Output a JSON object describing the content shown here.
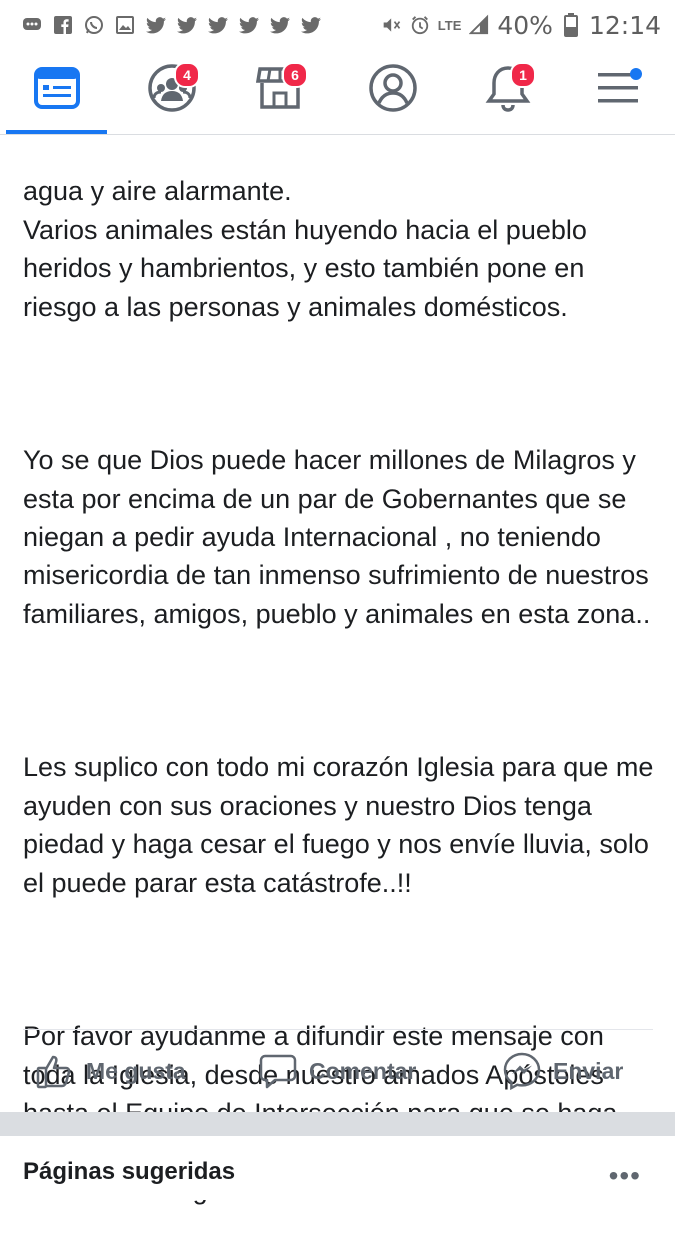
{
  "status_bar": {
    "battery": "40%",
    "time": "12:14",
    "network": "LTE",
    "icons": [
      "chat-bubble-icon",
      "facebook-icon",
      "whatsapp-icon",
      "image-icon",
      "twitter-icon",
      "twitter-icon",
      "twitter-icon",
      "twitter-icon",
      "twitter-icon",
      "twitter-icon",
      "mute-icon",
      "alarm-icon",
      "signal-icon",
      "battery-icon"
    ]
  },
  "tabs": [
    {
      "name": "news-feed",
      "icon": "feed-icon",
      "badge": "",
      "active": true
    },
    {
      "name": "groups",
      "icon": "groups-icon",
      "badge": "4"
    },
    {
      "name": "marketplace",
      "icon": "store-icon",
      "badge": "6"
    },
    {
      "name": "profile",
      "icon": "profile-icon",
      "badge": ""
    },
    {
      "name": "notifications",
      "icon": "bell-icon",
      "badge": "1"
    },
    {
      "name": "menu",
      "icon": "menu-icon",
      "badge": "",
      "dot": true
    }
  ],
  "post": {
    "paragraphs": [
      "agua y aire alarmante.\nVarios animales están huyendo hacia el pueblo heridos y hambrientos, y esto también pone en riesgo a las personas y animales domésticos.",
      "Yo se que Dios puede hacer millones de Milagros y esta por encima de un par de Gobernantes que se niegan a pedir ayuda Internacional , no teniendo misericordia de tan inmenso sufrimiento de nuestros familiares, amigos, pueblo y animales en esta zona..",
      "Les suplico con todo mi corazón Iglesia para que me ayuden con sus oraciones y nuestro Dios tenga piedad y haga cesar el fuego y nos envíe lluvia, solo el puede parar esta catástrofe..!!",
      "Por favor ayudanme a difundir este mensaje con toda la Iglesia, desde nuestro amados Apóstoles hasta el Equipo de Intersección para que se haga una cadena de oración gigante!! Muchas gracias, Dios los bendiga."
    ]
  },
  "actions": {
    "like": "Me gusta",
    "comment": "Comentar",
    "send": "Enviar"
  },
  "suggested": {
    "title": "Páginas sugeridas",
    "more": "•••"
  },
  "colors": {
    "accent": "#1877f2",
    "badge": "#f02849",
    "icon_gray": "#606770"
  }
}
